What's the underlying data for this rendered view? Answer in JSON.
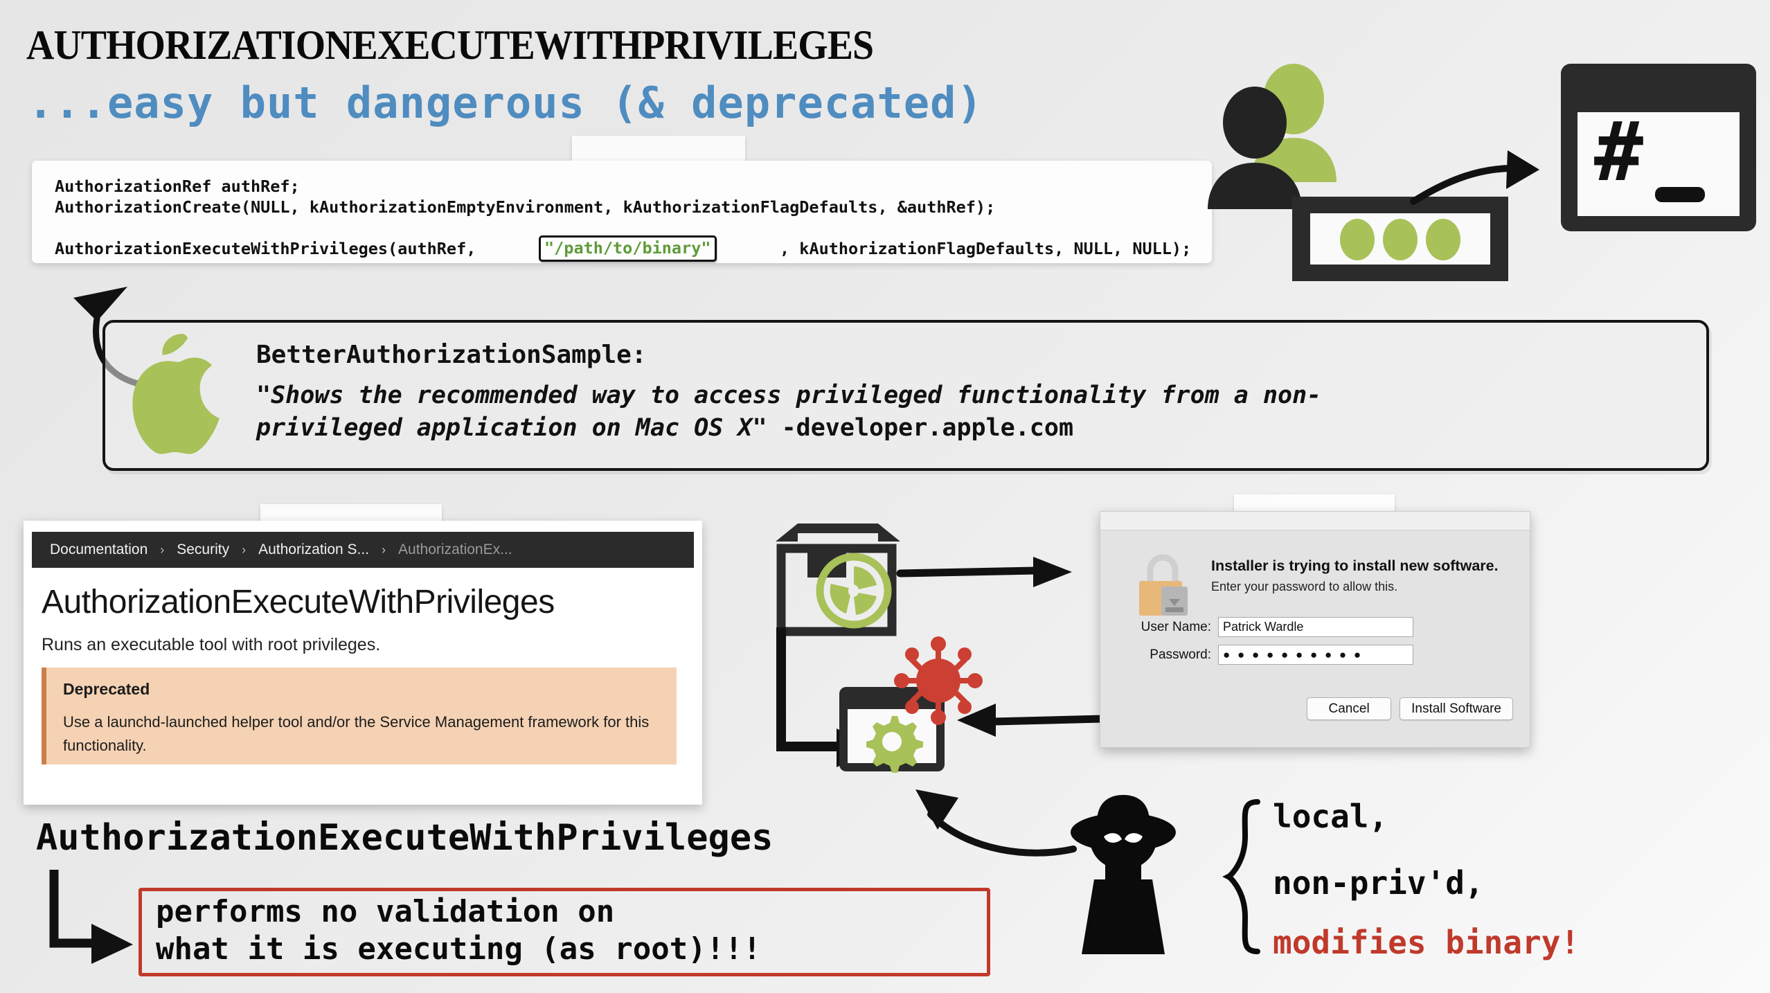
{
  "slide": {
    "title": "AuthorizationExecuteWithPrivileges",
    "subtitle": "...easy but dangerous (& deprecated)"
  },
  "code_block": {
    "line1": "AuthorizationRef authRef;",
    "line2": "AuthorizationCreate(NULL, kAuthorizationEmptyEnvironment, kAuthorizationFlagDefaults, &authRef);",
    "line3_prefix": "AuthorizationExecuteWithPrivileges(authRef, ",
    "highlight": "\"/path/to/binary\"",
    "line3_suffix": ", kAuthorizationFlagDefaults, NULL, NULL);",
    "highlight_color": "#5f9b3a"
  },
  "apple_quote": {
    "heading": "BetterAuthorizationSample:",
    "quote_line1": "\"Shows the recommended way to access privileged functionality from a non-",
    "quote_line2": "privileged application on Mac OS X\"",
    "attribution": " -developer.apple.com",
    "logo_icon": "apple-logo-icon",
    "logo_color": "#a8c159"
  },
  "doc_panel": {
    "breadcrumbs": [
      {
        "label": "Documentation",
        "dim": false
      },
      {
        "label": "Security",
        "dim": false
      },
      {
        "label": "Authorization S...",
        "dim": false
      },
      {
        "label": "AuthorizationEx...",
        "dim": true
      }
    ],
    "separator": "›",
    "title": "AuthorizationExecuteWithPrivileges",
    "description": "Runs an executable tool with root privileges.",
    "deprecated": {
      "heading": "Deprecated",
      "body": "Use a launchd-launched helper tool and/or the Service Management framework for this functionality.",
      "bg_color": "#f5d2b4",
      "accent_color": "#c87f4a"
    }
  },
  "auth_dialog": {
    "icon": "lock-icon",
    "heading": "Installer is trying to install new software.",
    "subheading": "Enter your password to allow this.",
    "username_label": "User Name:",
    "username_value": "Patrick Wardle",
    "password_label": "Password:",
    "password_value": "● ● ● ● ● ● ● ● ● ●",
    "cancel_label": "Cancel",
    "install_label": "Install Software"
  },
  "bottom": {
    "api_name": "AuthorizationExecuteWithPrivileges",
    "warn_line1": "performs no validation on",
    "warn_line2": "what it is executing (as root)!!!",
    "warn_border_color": "#c0392b"
  },
  "attacker": {
    "icon": "hacker-icon",
    "items": [
      {
        "label": "local,",
        "color": "#0b0b0b"
      },
      {
        "label": "non-priv'd,",
        "color": "#0b0b0b"
      },
      {
        "label": "modifies binary!",
        "color": "#c0392b"
      }
    ]
  },
  "icons": {
    "users": "users-icon",
    "dialog_dots": "dialog-window-icon",
    "terminal": "terminal-root-icon",
    "terminal_prompt": "#",
    "package": "package-box-icon",
    "disc": "install-disc-icon",
    "virus": "virus-icon",
    "gear_window": "gear-window-icon",
    "green": "#a8c159",
    "red": "#cc4033",
    "dark": "#2b2b2b"
  }
}
